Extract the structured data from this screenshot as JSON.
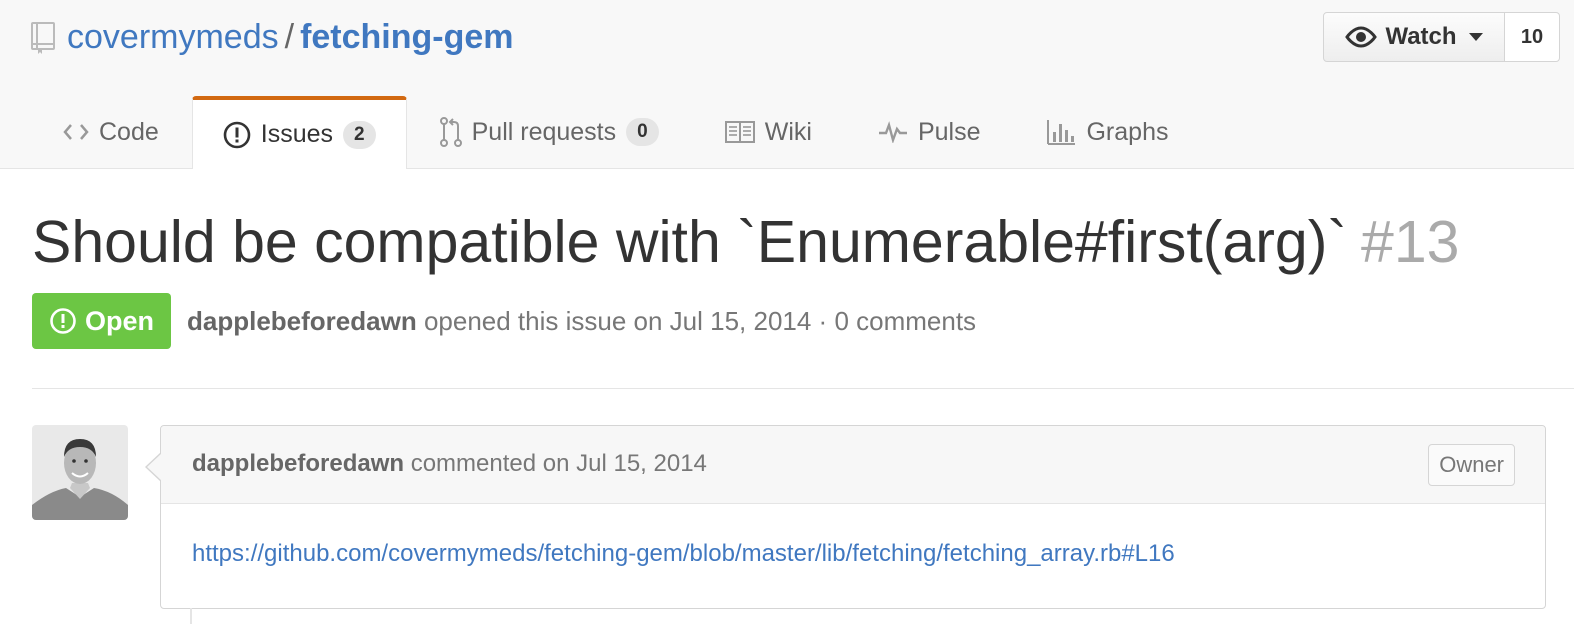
{
  "repo": {
    "owner": "covermymeds",
    "separator": "/",
    "name": "fetching-gem"
  },
  "watch": {
    "label": "Watch",
    "count": "10"
  },
  "tabs": [
    {
      "label": "Code",
      "icon": "code-icon"
    },
    {
      "label": "Issues",
      "icon": "issue-opened-icon",
      "count": "2",
      "selected": true
    },
    {
      "label": "Pull requests",
      "icon": "git-pull-request-icon",
      "count": "0"
    },
    {
      "label": "Wiki",
      "icon": "book-icon"
    },
    {
      "label": "Pulse",
      "icon": "pulse-icon"
    },
    {
      "label": "Graphs",
      "icon": "graph-icon"
    }
  ],
  "issue": {
    "title": "Should be compatible with `Enumerable#first(arg)`",
    "number": "#13",
    "state": "Open",
    "author": "dapplebeforedawn",
    "meta": "opened this issue on Jul 15, 2014 · 0 comments"
  },
  "comment": {
    "author": "dapplebeforedawn",
    "action": "commented on Jul 15, 2014",
    "role": "Owner",
    "body_link": "https://github.com/covermymeds/fetching-gem/blob/master/lib/fetching/fetching_array.rb#L16"
  },
  "colors": {
    "link": "#4078c0",
    "open_badge": "#6cc644",
    "tab_accent": "#d26911"
  }
}
